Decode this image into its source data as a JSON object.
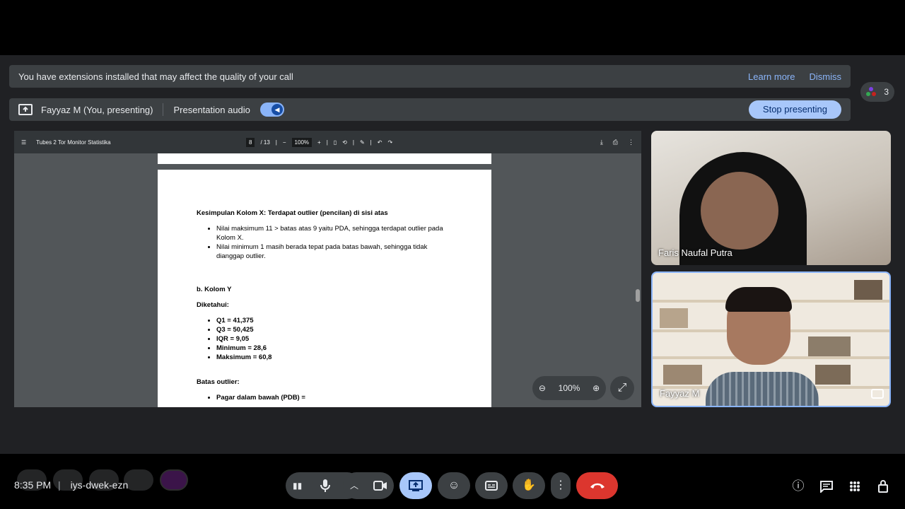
{
  "extensions_banner": {
    "message": "You have extensions installed that may affect the quality of your call",
    "learn_more": "Learn more",
    "dismiss": "Dismiss"
  },
  "presenting_banner": {
    "presenter": "Fayyaz M (You, presenting)",
    "audio_label": "Presentation audio",
    "audio_on": true,
    "stop_label": "Stop presenting"
  },
  "participants": {
    "count": "3",
    "dot_colors": [
      "#7b3fe4",
      "#34a853",
      "#c5221f"
    ]
  },
  "pdf": {
    "title": "Tubes 2 Tor Monitor Statistika",
    "page_current": "8",
    "page_total": "/ 13",
    "zoom": "100%",
    "content": {
      "heading": "Kesimpulan Kolom X: Terdapat outlier (pencilan) di sisi atas",
      "bullets_x": [
        "Nilai maksimum 11 > batas atas 9 yaitu PDA, sehingga terdapat outlier pada Kolom X.",
        "Nilai minimum 1 masih berada tepat pada batas bawah, sehingga tidak dianggap outlier."
      ],
      "subheading": "b. Kolom Y",
      "diketahui": "Diketahui:",
      "stats": [
        "Q1 = 41,375",
        "Q3 = 50,425",
        "IQR = 9,05",
        "Minimum = 28,6",
        "Maksimum = 60,8"
      ],
      "batas": "Batas outlier:",
      "pdb": "Pagar dalam bawah (PDB) ="
    }
  },
  "overlay_zoom": {
    "value": "100%"
  },
  "tiles": [
    {
      "name": "Faris Naufal Putra"
    },
    {
      "name": "Fayyaz M"
    }
  ],
  "bottom": {
    "time": "8:35 PM",
    "separator": "|",
    "meeting_code": "iys-dwek-ezn"
  },
  "icons": {
    "mic": "mic-icon",
    "camera": "camera-icon",
    "present": "present-icon",
    "emoji": "emoji-icon",
    "captions": "captions-icon",
    "hand": "hand-icon",
    "more": "more-vert-icon",
    "end": "end-call-icon",
    "info": "info-icon",
    "chat": "chat-icon",
    "activities": "apps-icon",
    "lock": "host-controls-icon"
  }
}
